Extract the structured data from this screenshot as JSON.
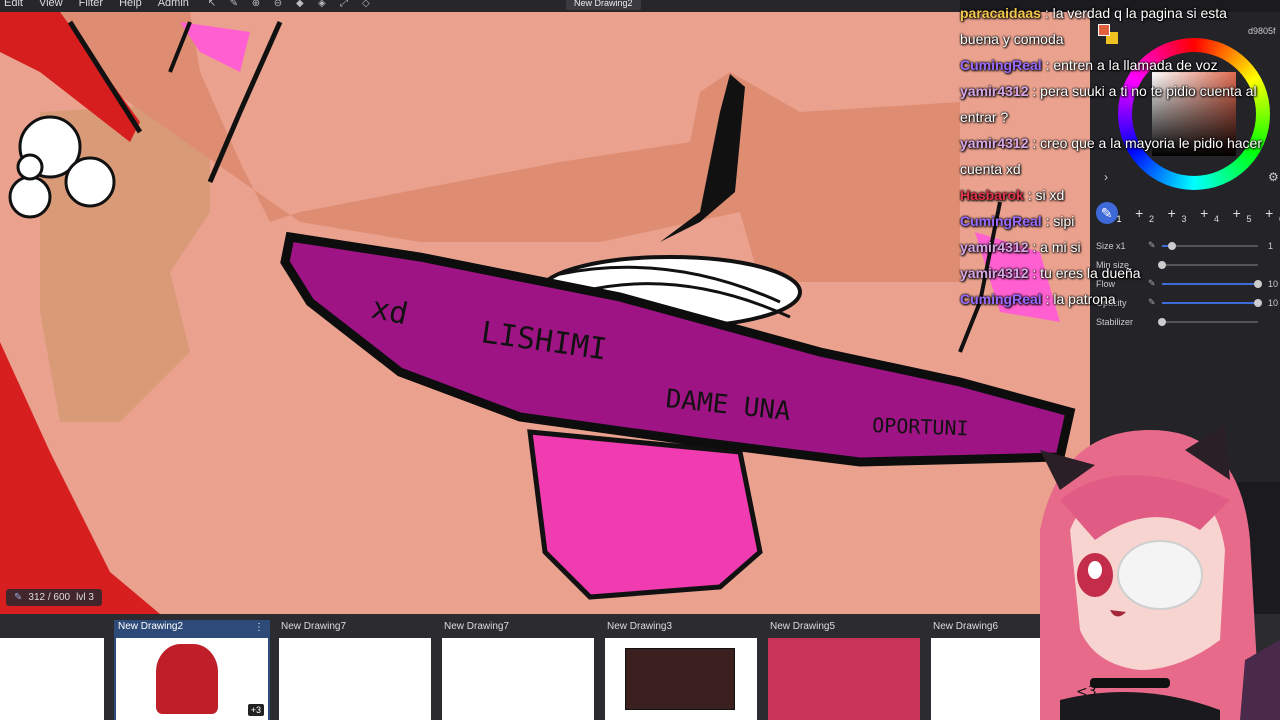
{
  "menu": [
    "Edit",
    "View",
    "Filter",
    "Help",
    "Admin"
  ],
  "toolbar_icons": [
    "pointer-icon",
    "pen-icon",
    "zoom-in-icon",
    "zoom-out-icon",
    "fill-icon",
    "eraser-icon",
    "move-icon",
    "transform-icon"
  ],
  "document_tab": "New Drawing2",
  "canvas": {
    "counter": "312 / 600",
    "counter_extra": "lvl 3",
    "lettering": [
      "xd",
      "LISHIMI",
      "DAME UNA",
      "OPORTUNI"
    ]
  },
  "chat": [
    {
      "user": "paracaidaas",
      "color": "#f2c84b",
      "text": " : la verdad q la pagina si esta buena y comoda"
    },
    {
      "user": "CumingReal",
      "color": "#9b6bff",
      "text": " : entren a la llamada de voz"
    },
    {
      "user": "yamir4312",
      "color": "#d9a7e6",
      "text": " : pera suuki a ti no te pidio cuenta al entrar ?"
    },
    {
      "user": "yamir4312",
      "color": "#d9a7e6",
      "text": " : creo que a la mayoria le pidio hacer cuenta xd"
    },
    {
      "user": "Hasbarok",
      "color": "#e0344a",
      "text": " : si xd"
    },
    {
      "user": "CumingReal",
      "color": "#9b6bff",
      "text": " : sipi"
    },
    {
      "user": "yamir4312",
      "color": "#d9a7e6",
      "text": " : a mi si"
    },
    {
      "user": "yamir4312",
      "color": "#d9a7e6",
      "text": " : tu eres la dueña"
    },
    {
      "user": "CumingReal",
      "color": "#9b6bff",
      "text": " : la patrona"
    }
  ],
  "color_panel": {
    "hex": "d9805f",
    "primary": "#e0603f",
    "secondary": "#f0c020"
  },
  "brushes": [
    {
      "num": "1",
      "active": true
    },
    {
      "num": "2",
      "active": false
    },
    {
      "num": "3",
      "active": false
    },
    {
      "num": "4",
      "active": false
    },
    {
      "num": "5",
      "active": false
    },
    {
      "num": "6",
      "active": false
    }
  ],
  "sliders": [
    {
      "label": "Size x1",
      "value": 0.1,
      "num": "1"
    },
    {
      "label": "Min size",
      "value": 0.0,
      "num": ""
    },
    {
      "label": "Flow",
      "value": 1.0,
      "num": "10"
    },
    {
      "label": "Opacity",
      "value": 1.0,
      "num": "10"
    },
    {
      "label": "Stabilizer",
      "value": 0.0,
      "num": ""
    }
  ],
  "thumbnails": [
    {
      "title": "",
      "active": false
    },
    {
      "title": "New Drawing2",
      "active": true,
      "badge": "+3"
    },
    {
      "title": "New Drawing7",
      "active": false
    },
    {
      "title": "New Drawing7",
      "active": false
    },
    {
      "title": "New Drawing3",
      "active": false
    },
    {
      "title": "New Drawing5",
      "active": false
    },
    {
      "title": "New Drawing6",
      "active": false
    }
  ],
  "avatar": {
    "caption": "<3"
  }
}
